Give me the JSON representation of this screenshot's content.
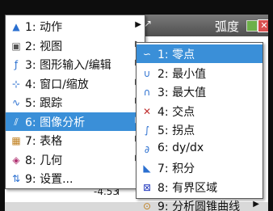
{
  "topbar": {
    "title": "弧度",
    "arrow": "↗",
    "close": "✕"
  },
  "main_menu": [
    {
      "label": "1: 动作",
      "icon": "cursor-icon",
      "glyph": "▲",
      "color": "#2a6fd0"
    },
    {
      "label": "2: 视图",
      "icon": "view-icon",
      "glyph": "▣",
      "color": "#555"
    },
    {
      "label": "3: 图形输入/编辑",
      "icon": "graph-entry-icon",
      "glyph": "ƒ",
      "color": "#2a6fd0"
    },
    {
      "label": "4: 窗口/缩放",
      "icon": "window-zoom-icon",
      "glyph": "⊹",
      "color": "#2a6fd0"
    },
    {
      "label": "5: 跟踪",
      "icon": "trace-icon",
      "glyph": "∿",
      "color": "#2a6fd0"
    },
    {
      "label": "6: 图像分析",
      "icon": "analyze-graph-icon",
      "glyph": "⫽",
      "color": "#ffffff",
      "selected": true
    },
    {
      "label": "7: 表格",
      "icon": "table-icon",
      "glyph": "▦",
      "color": "#c08020"
    },
    {
      "label": "8: 几何",
      "icon": "geometry-icon",
      "glyph": "◈",
      "color": "#b03070"
    },
    {
      "label": "9: 设置...",
      "icon": "settings-icon",
      "glyph": "⇅",
      "color": "#2a6fd0"
    }
  ],
  "sub_menu": [
    {
      "label": "1: 零点",
      "icon": "zero-icon",
      "glyph": "∽",
      "color": "#ffffff",
      "selected": true
    },
    {
      "label": "2: 最小值",
      "icon": "minimum-icon",
      "glyph": "∪",
      "color": "#2a6fd0"
    },
    {
      "label": "3: 最大值",
      "icon": "maximum-icon",
      "glyph": "∩",
      "color": "#2a6fd0"
    },
    {
      "label": "4: 交点",
      "icon": "intersection-icon",
      "glyph": "✕",
      "color": "#c03030"
    },
    {
      "label": "5: 拐点",
      "icon": "inflection-icon",
      "glyph": "∫",
      "color": "#2a6fd0"
    },
    {
      "label": "6: dy/dx",
      "icon": "derivative-icon",
      "glyph": "∂",
      "color": "#2a6fd0"
    },
    {
      "label": "7: 积分",
      "icon": "integral-icon",
      "glyph": "◣",
      "color": "#2a6fd0"
    },
    {
      "label": "8: 有界区域",
      "icon": "bounded-area-icon",
      "glyph": "⊠",
      "color": "#2a40c0"
    },
    {
      "label": "9: 分析圆锥曲线",
      "icon": "conic-icon",
      "glyph": "⊙",
      "color": "#c08020"
    }
  ],
  "axis": {
    "value": "-4.53"
  }
}
